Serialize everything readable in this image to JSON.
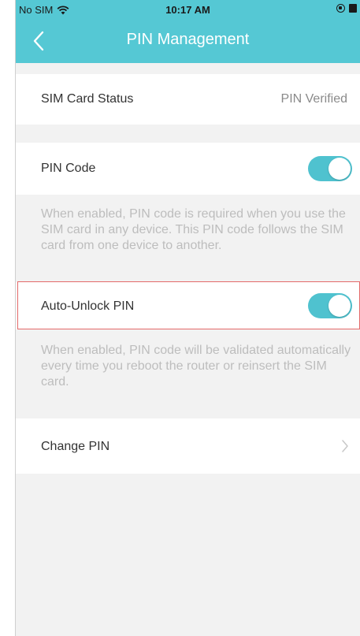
{
  "status_bar": {
    "carrier": "No SIM",
    "time": "10:17 AM",
    "wifi_icon": "wifi-icon",
    "orientation_lock_icon": "orientation-lock-icon",
    "battery_icon": "battery-icon"
  },
  "nav": {
    "title": "PIN Management",
    "back_icon": "chevron-left-icon"
  },
  "sim_status": {
    "label": "SIM Card Status",
    "value": "PIN Verified"
  },
  "pin_code": {
    "label": "PIN Code",
    "enabled": true,
    "description": "When enabled, PIN code is required when you use the SIM card in any device. This PIN code follows the SIM card from one device to another."
  },
  "auto_unlock": {
    "label": "Auto-Unlock PIN",
    "enabled": true,
    "description": "When enabled, PIN code will be validated automatically every time you reboot the router or reinsert the SIM card."
  },
  "change_pin": {
    "label": "Change PIN",
    "chevron_icon": "chevron-right-icon"
  },
  "colors": {
    "accent": "#55c8d4",
    "toggle_on": "#4fc2cf",
    "background": "#f2f2f2",
    "highlight": "#e46a6a"
  }
}
